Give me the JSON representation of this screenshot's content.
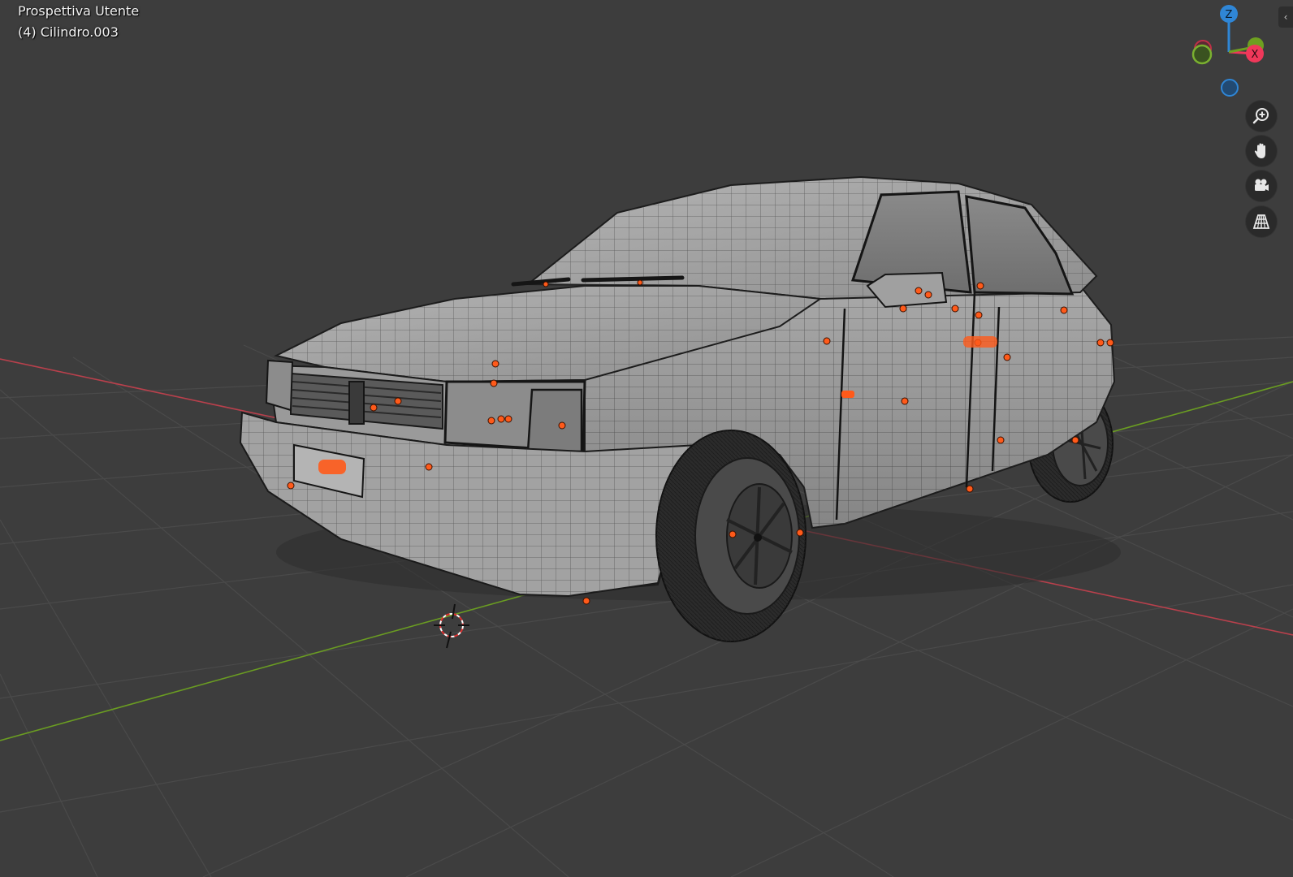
{
  "viewport": {
    "view_name": "Prospettiva Utente",
    "object_name": "(4) Cilindro.003",
    "background_color": "#3d3d3d"
  },
  "gizmo": {
    "z_label": "Z",
    "x_label": "X",
    "z_color": "#2f86d6",
    "x_color": "#f0385a",
    "y_color": "#6ea020"
  },
  "navigation": {
    "zoom_icon": "zoom-in-icon",
    "pan_icon": "hand-icon",
    "camera_icon": "camera-icon",
    "perspective_icon": "perspective-grid-icon"
  },
  "scene": {
    "object": "car-wireframe-model",
    "selection_color": "#ff5a1a"
  }
}
